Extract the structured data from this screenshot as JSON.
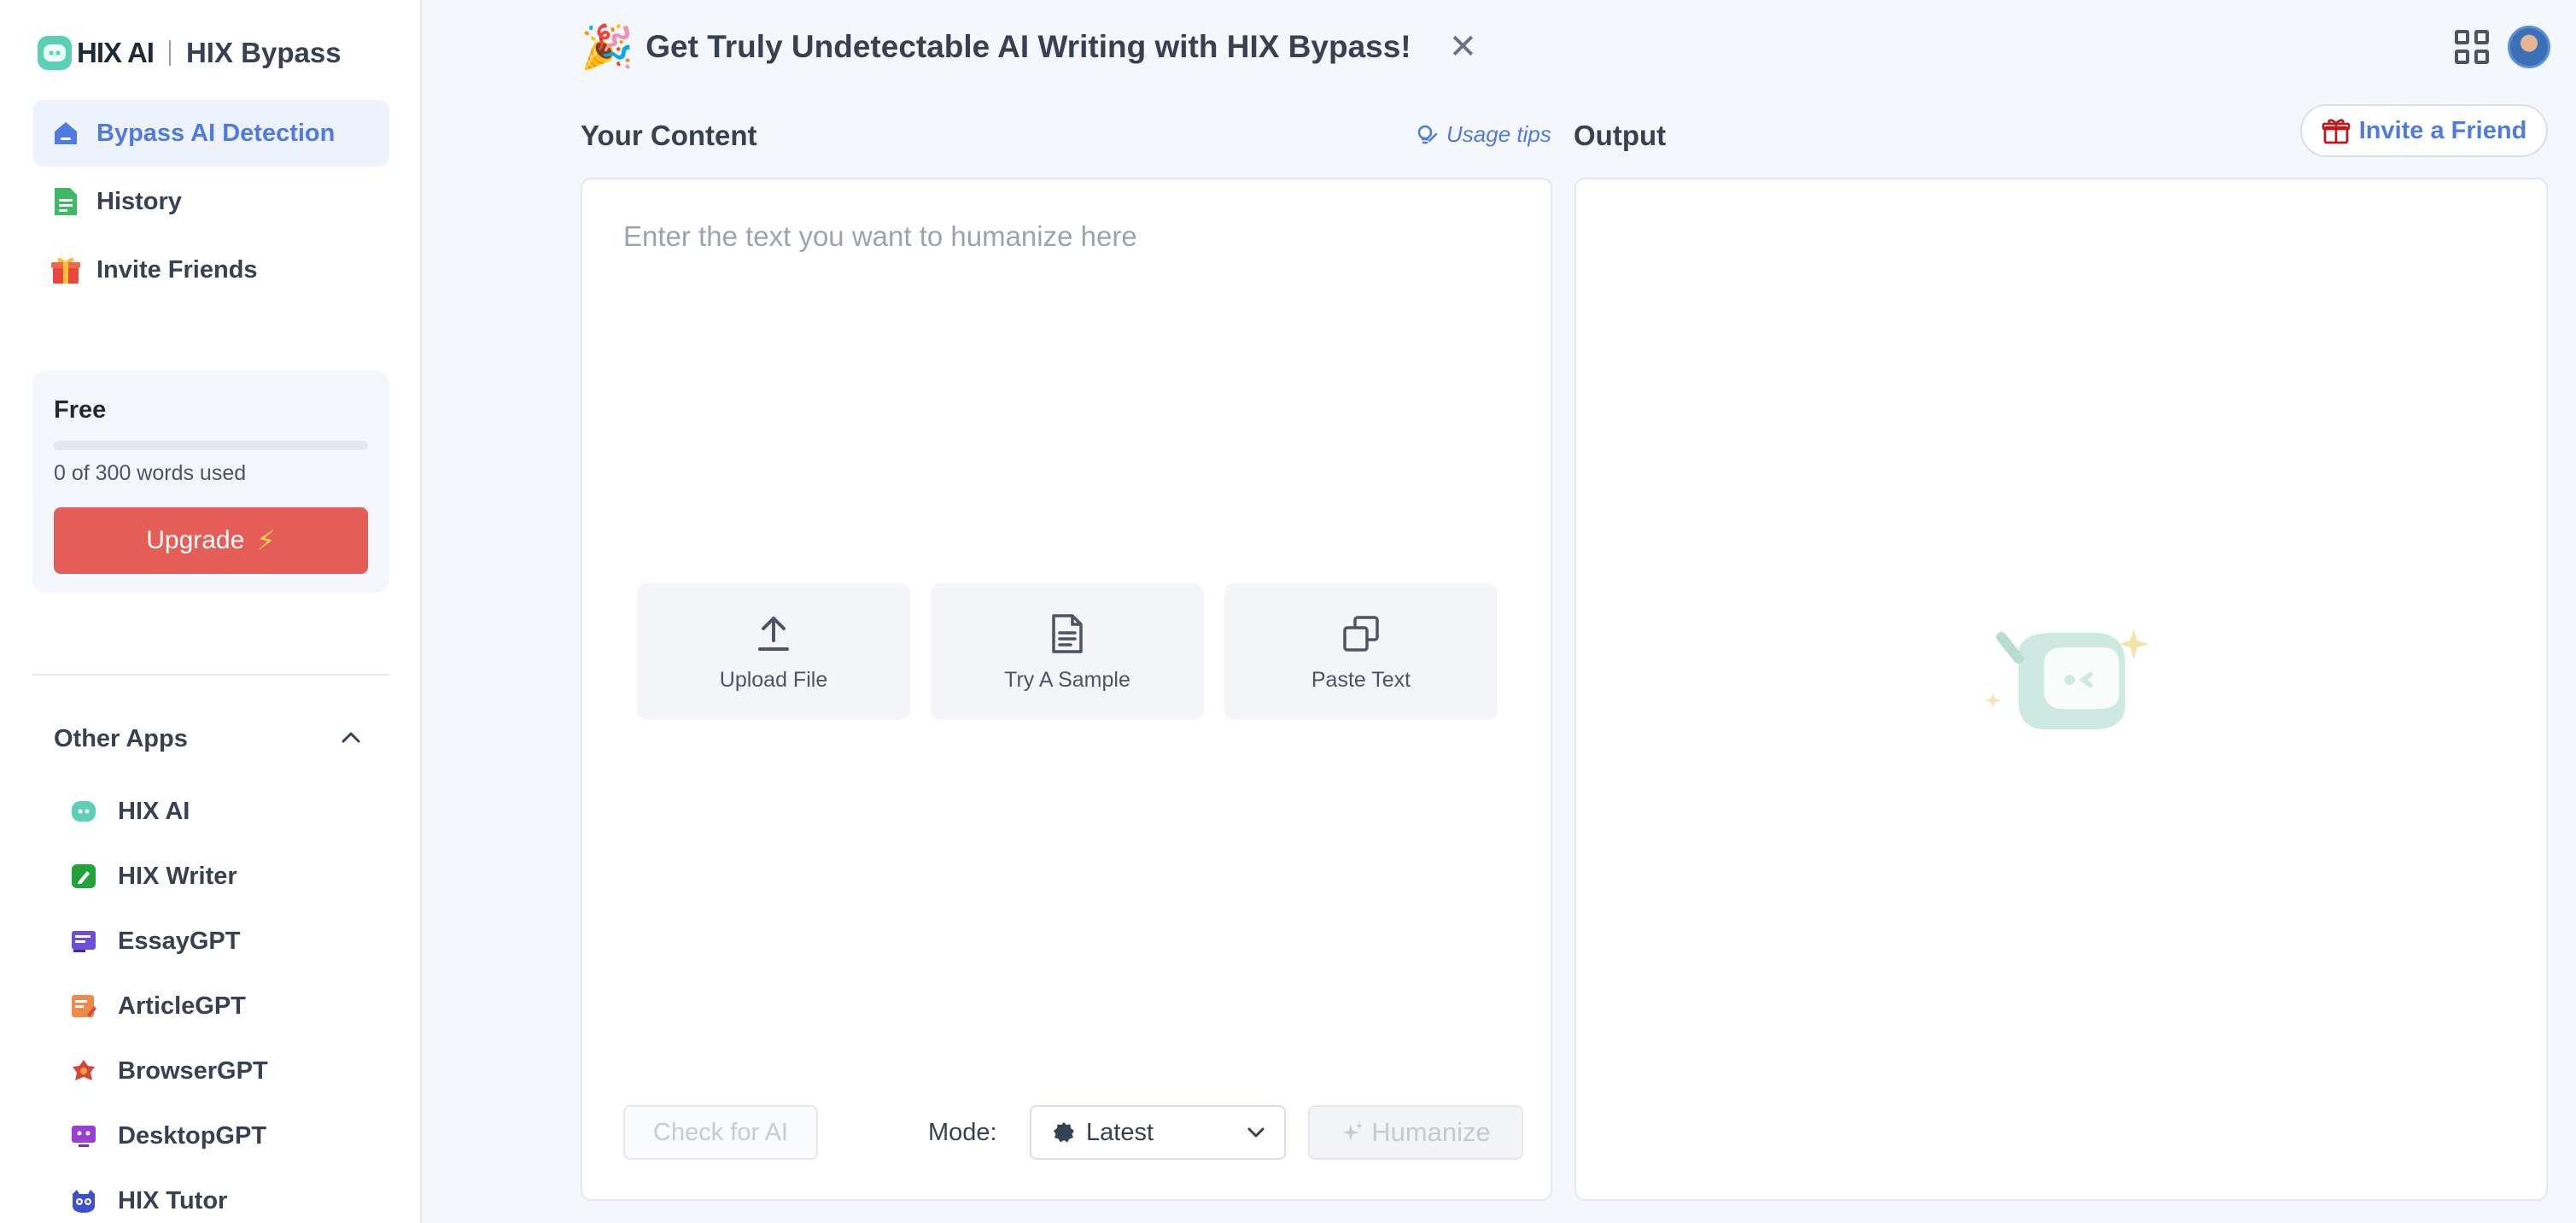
{
  "brand": {
    "logo": "HIX AI",
    "product": "HIX Bypass"
  },
  "sidebar": {
    "items": [
      {
        "label": "Bypass AI Detection",
        "icon": "home-icon",
        "active": true
      },
      {
        "label": "History",
        "icon": "document-icon",
        "active": false
      },
      {
        "label": "Invite Friends",
        "icon": "gift-icon",
        "active": false
      }
    ]
  },
  "plan": {
    "name": "Free",
    "usage_text": "0 of 300 words used",
    "used_fraction": 0,
    "upgrade_label": "Upgrade",
    "upgrade_icon": "bolt-icon"
  },
  "other_apps": {
    "title": "Other Apps",
    "expanded": true,
    "items": [
      {
        "label": "HIX AI",
        "icon": "hix-ai-icon",
        "color": "#5ccfb6"
      },
      {
        "label": "HIX Writer",
        "icon": "hix-writer-icon",
        "color": "#22a33a"
      },
      {
        "label": "EssayGPT",
        "icon": "essaygpt-icon",
        "color": "#6d4ed6"
      },
      {
        "label": "ArticleGPT",
        "icon": "articlegpt-icon",
        "color": "#e0763a"
      },
      {
        "label": "BrowserGPT",
        "icon": "browsergpt-icon",
        "color": "#d2463c"
      },
      {
        "label": "DesktopGPT",
        "icon": "desktopgpt-icon",
        "color": "#9b3fd1"
      },
      {
        "label": "HIX Tutor",
        "icon": "hix-tutor-icon",
        "color": "#3e4fcf"
      }
    ]
  },
  "banner": {
    "icon": "party-popper-icon",
    "text": "Get Truly Undetectable AI Writing with HIX Bypass!",
    "close_icon": "close-icon"
  },
  "content": {
    "title": "Your Content",
    "usage_tips": "Usage tips",
    "placeholder": "Enter the text you want to humanize here",
    "value": "",
    "actions": [
      {
        "label": "Upload File",
        "icon": "upload-icon"
      },
      {
        "label": "Try A Sample",
        "icon": "sample-document-icon"
      },
      {
        "label": "Paste Text",
        "icon": "paste-icon"
      }
    ],
    "check_label": "Check for AI",
    "mode_label": "Mode:",
    "mode_value": "Latest",
    "humanize_label": "Humanize"
  },
  "output": {
    "title": "Output",
    "invite_label": "Invite a Friend"
  },
  "colors": {
    "accent": "#4f7be0",
    "upgrade": "#e45d57",
    "background": "#f4f7fc"
  }
}
